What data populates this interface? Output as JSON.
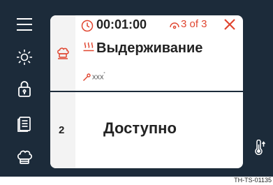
{
  "timer": {
    "value": "00:01:00",
    "icon": "clock-icon"
  },
  "step": {
    "counter": "3 of 3",
    "icon": "steps-icon"
  },
  "mode": {
    "title": "Выдерживание",
    "icon": "holding-heat-icon",
    "oven_icon": "oven-icon"
  },
  "probe": {
    "value": "xxx",
    "unit": "˚",
    "icon": "core-probe-icon"
  },
  "slot": {
    "number": "2",
    "status": "Доступно"
  },
  "sidebar": {
    "items": [
      {
        "icon": "menu-icon"
      },
      {
        "icon": "brightness-icon"
      },
      {
        "icon": "lock-icon"
      },
      {
        "icon": "recipe-book-icon"
      },
      {
        "icon": "chef-hat-icon"
      }
    ]
  },
  "footer": {
    "code": "TH-TS-01135"
  },
  "colors": {
    "background": "#1c2b3a",
    "card": "#ffffff",
    "accent": "#e0452f",
    "icon_light": "#ffffff",
    "text": "#222222"
  }
}
